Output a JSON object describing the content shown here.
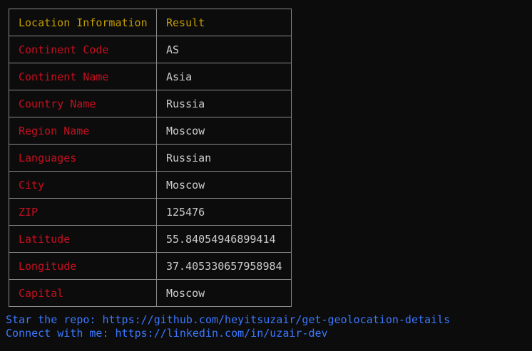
{
  "table": {
    "headers": [
      "Location Information",
      "Result"
    ],
    "rows": [
      {
        "key": "Continent Code",
        "value": "AS"
      },
      {
        "key": "Continent Name",
        "value": "Asia"
      },
      {
        "key": "Country Name",
        "value": "Russia"
      },
      {
        "key": "Region Name",
        "value": "Moscow"
      },
      {
        "key": "Languages",
        "value": "Russian"
      },
      {
        "key": "City",
        "value": "Moscow"
      },
      {
        "key": "ZIP",
        "value": "125476"
      },
      {
        "key": "Latitude",
        "value": "55.84054946899414"
      },
      {
        "key": "Longitude",
        "value": "37.405330657958984"
      },
      {
        "key": "Capital",
        "value": "Moscow"
      }
    ]
  },
  "footer": {
    "star_line": "Star the repo: https://github.com/heyitsuzair/get-geolocation-details",
    "connect_line": "Connect with me: https://linkedin.com/in/uzair-dev"
  },
  "colors": {
    "background": "#0c0c0c",
    "header_text": "#c19c00",
    "key_text": "#c50f1f",
    "value_text": "#cccccc",
    "link_text": "#3b78ff",
    "border": "#8a8a8a"
  }
}
